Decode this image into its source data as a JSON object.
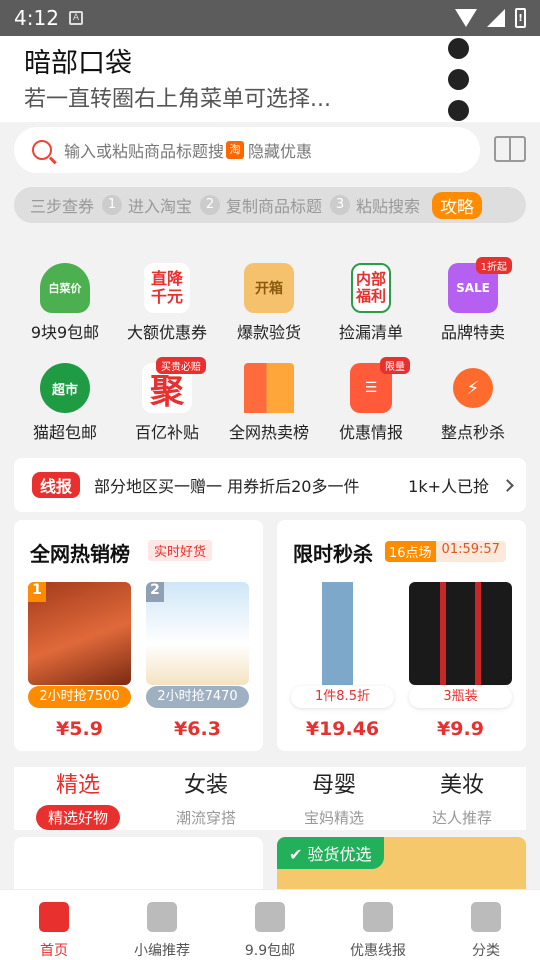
{
  "status_bar": {
    "time": "4:12"
  },
  "notice": {
    "title": "暗部口袋",
    "subtitle": "若一直转圈右上角菜单可选择..."
  },
  "search": {
    "placeholder": "输入或粘贴商品标题搜",
    "tao_icon_text": "淘",
    "hidden_coupon": "隐藏优惠"
  },
  "steps": {
    "label": "三步查券",
    "items": [
      {
        "num": "1",
        "text": "进入淘宝"
      },
      {
        "num": "2",
        "text": "复制商品标题"
      },
      {
        "num": "3",
        "text": "粘贴搜索"
      }
    ],
    "guide": "攻略"
  },
  "grid": {
    "row1": [
      {
        "label": "9块9包邮",
        "icon_text": "白菜价"
      },
      {
        "label": "大额优惠券",
        "icon_text": "直降千元"
      },
      {
        "label": "爆款验货",
        "icon_text": "开箱"
      },
      {
        "label": "捡漏清单",
        "icon_text": "内部福利"
      },
      {
        "label": "品牌特卖",
        "icon_text": "SALE",
        "tag": "1折起"
      }
    ],
    "row2": [
      {
        "label": "猫超包邮",
        "icon_text": "超市"
      },
      {
        "label": "百亿补贴",
        "icon_text": "聚",
        "tag": "买贵必赔"
      },
      {
        "label": "全网热卖榜",
        "icon_text": ""
      },
      {
        "label": "优惠情报",
        "icon_text": "",
        "tag": "限量"
      },
      {
        "label": "整点秒杀",
        "icon_text": ""
      }
    ]
  },
  "ticker": {
    "badge": "线报",
    "text": "部分地区买一赠一 用券折后20多一件",
    "count": "1k+人已抢"
  },
  "hot_card": {
    "title": "全网热销榜",
    "badge": "实时好货",
    "products": [
      {
        "rank": "1",
        "pill": "2小时抢7500",
        "price": "¥5.9"
      },
      {
        "rank": "2",
        "pill": "2小时抢7470",
        "price": "¥6.3"
      }
    ]
  },
  "flash_card": {
    "title": "限时秒杀",
    "session": "16点场",
    "countdown": "01:59:57",
    "products": [
      {
        "pill": "1件8.5折",
        "price": "¥19.46"
      },
      {
        "pill": "3瓶装",
        "price": "¥9.9"
      }
    ]
  },
  "tabs": [
    {
      "title": "精选",
      "sub": "精选好物"
    },
    {
      "title": "女装",
      "sub": "潮流穿搭"
    },
    {
      "title": "母婴",
      "sub": "宝妈精选"
    },
    {
      "title": "美妆",
      "sub": "达人推荐"
    }
  ],
  "feed": {
    "badge": "验货优选"
  },
  "nav": [
    {
      "label": "首页",
      "icon": "home-icon"
    },
    {
      "label": "小编推荐",
      "icon": "star-badge-icon"
    },
    {
      "label": "9.9包邮",
      "icon": "nine-nine-icon"
    },
    {
      "label": "优惠线报",
      "icon": "document-icon"
    },
    {
      "label": "分类",
      "icon": "grid-icon"
    }
  ],
  "colors": {
    "accent": "#e8302f",
    "orange": "#ff8c00",
    "green": "#22b05a"
  }
}
